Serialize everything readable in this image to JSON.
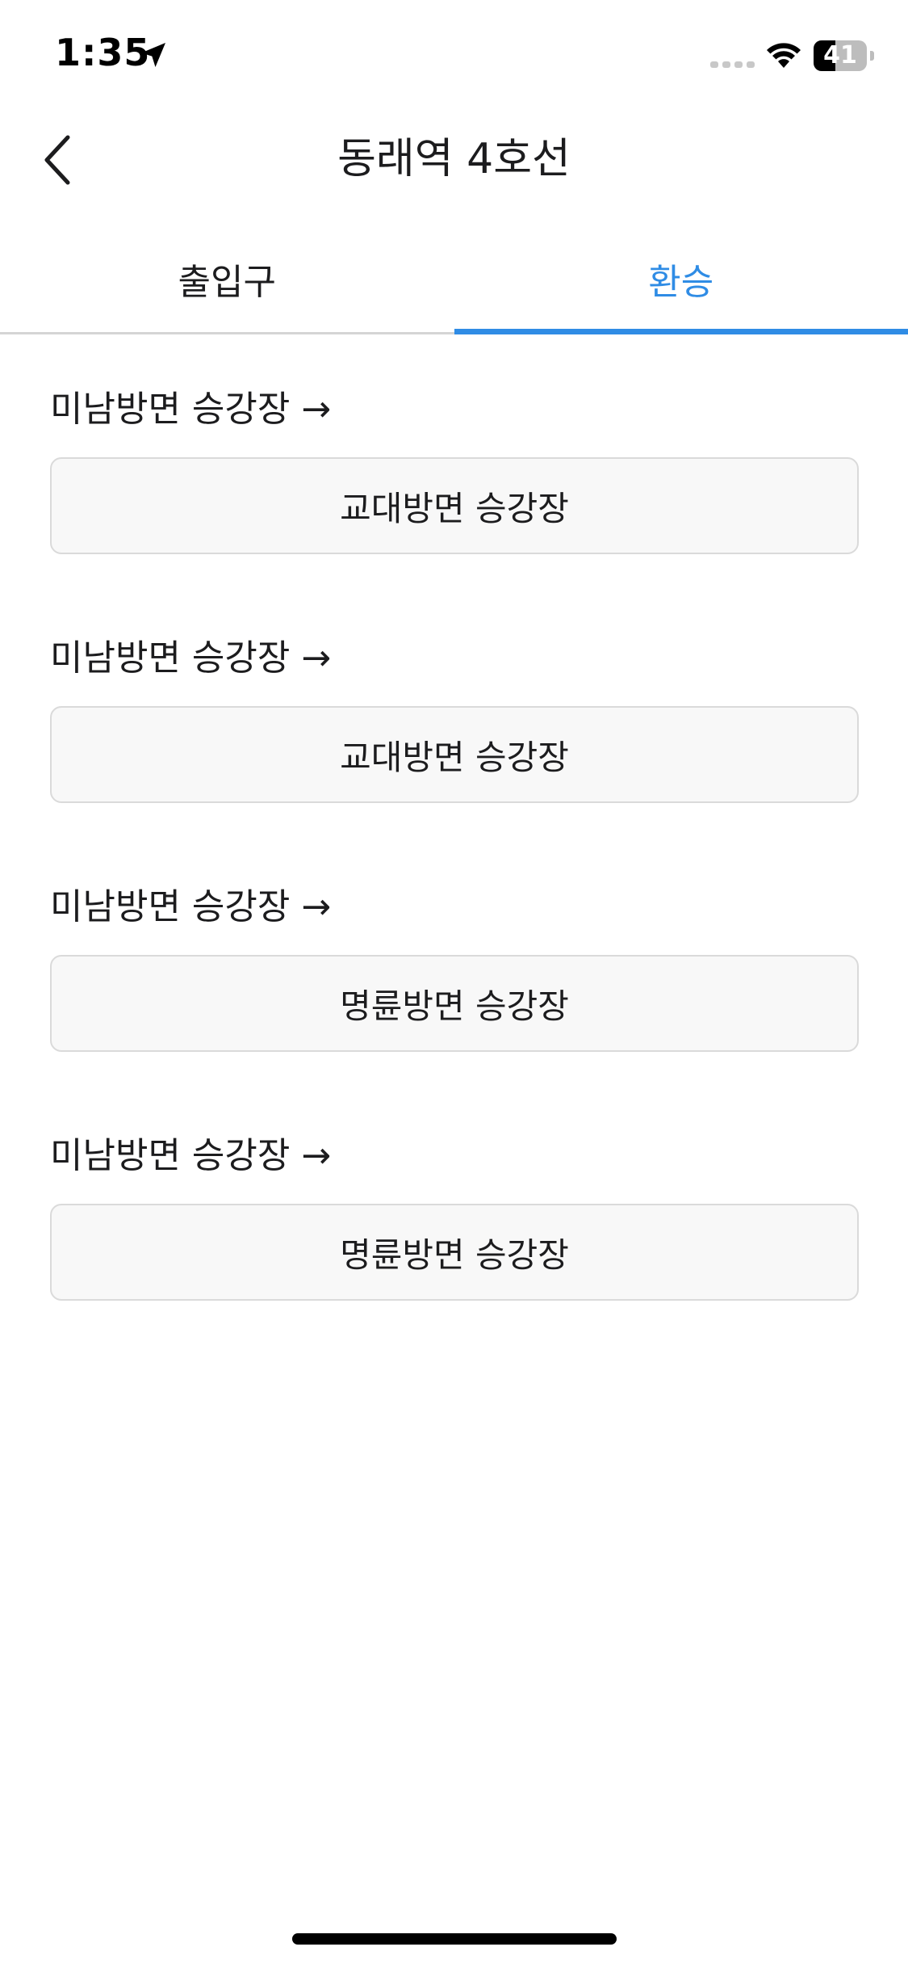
{
  "status_bar": {
    "time": "1:35",
    "battery_percent": "41",
    "battery_level": 0.41,
    "icons": [
      "location-arrow-icon",
      "cellular-signal-icon",
      "wifi-icon",
      "battery-icon"
    ]
  },
  "header": {
    "title": "동래역 4호선",
    "back_icon": "chevron-left-icon"
  },
  "tabs": [
    {
      "label": "출입구",
      "active": false
    },
    {
      "label": "환승",
      "active": true
    }
  ],
  "transfers": [
    {
      "from": "미남방면 승강장 →",
      "to": "교대방면 승강장"
    },
    {
      "from": "미남방면 승강장 →",
      "to": "교대방면 승강장"
    },
    {
      "from": "미남방면 승강장 →",
      "to": "명륜방면 승강장"
    },
    {
      "from": "미남방면 승강장 →",
      "to": "명륜방면 승강장"
    }
  ],
  "colors": {
    "accent": "#2f8ce5",
    "text": "#1c1c1e",
    "button_bg": "#f8f8f8",
    "button_border": "#dadada"
  }
}
